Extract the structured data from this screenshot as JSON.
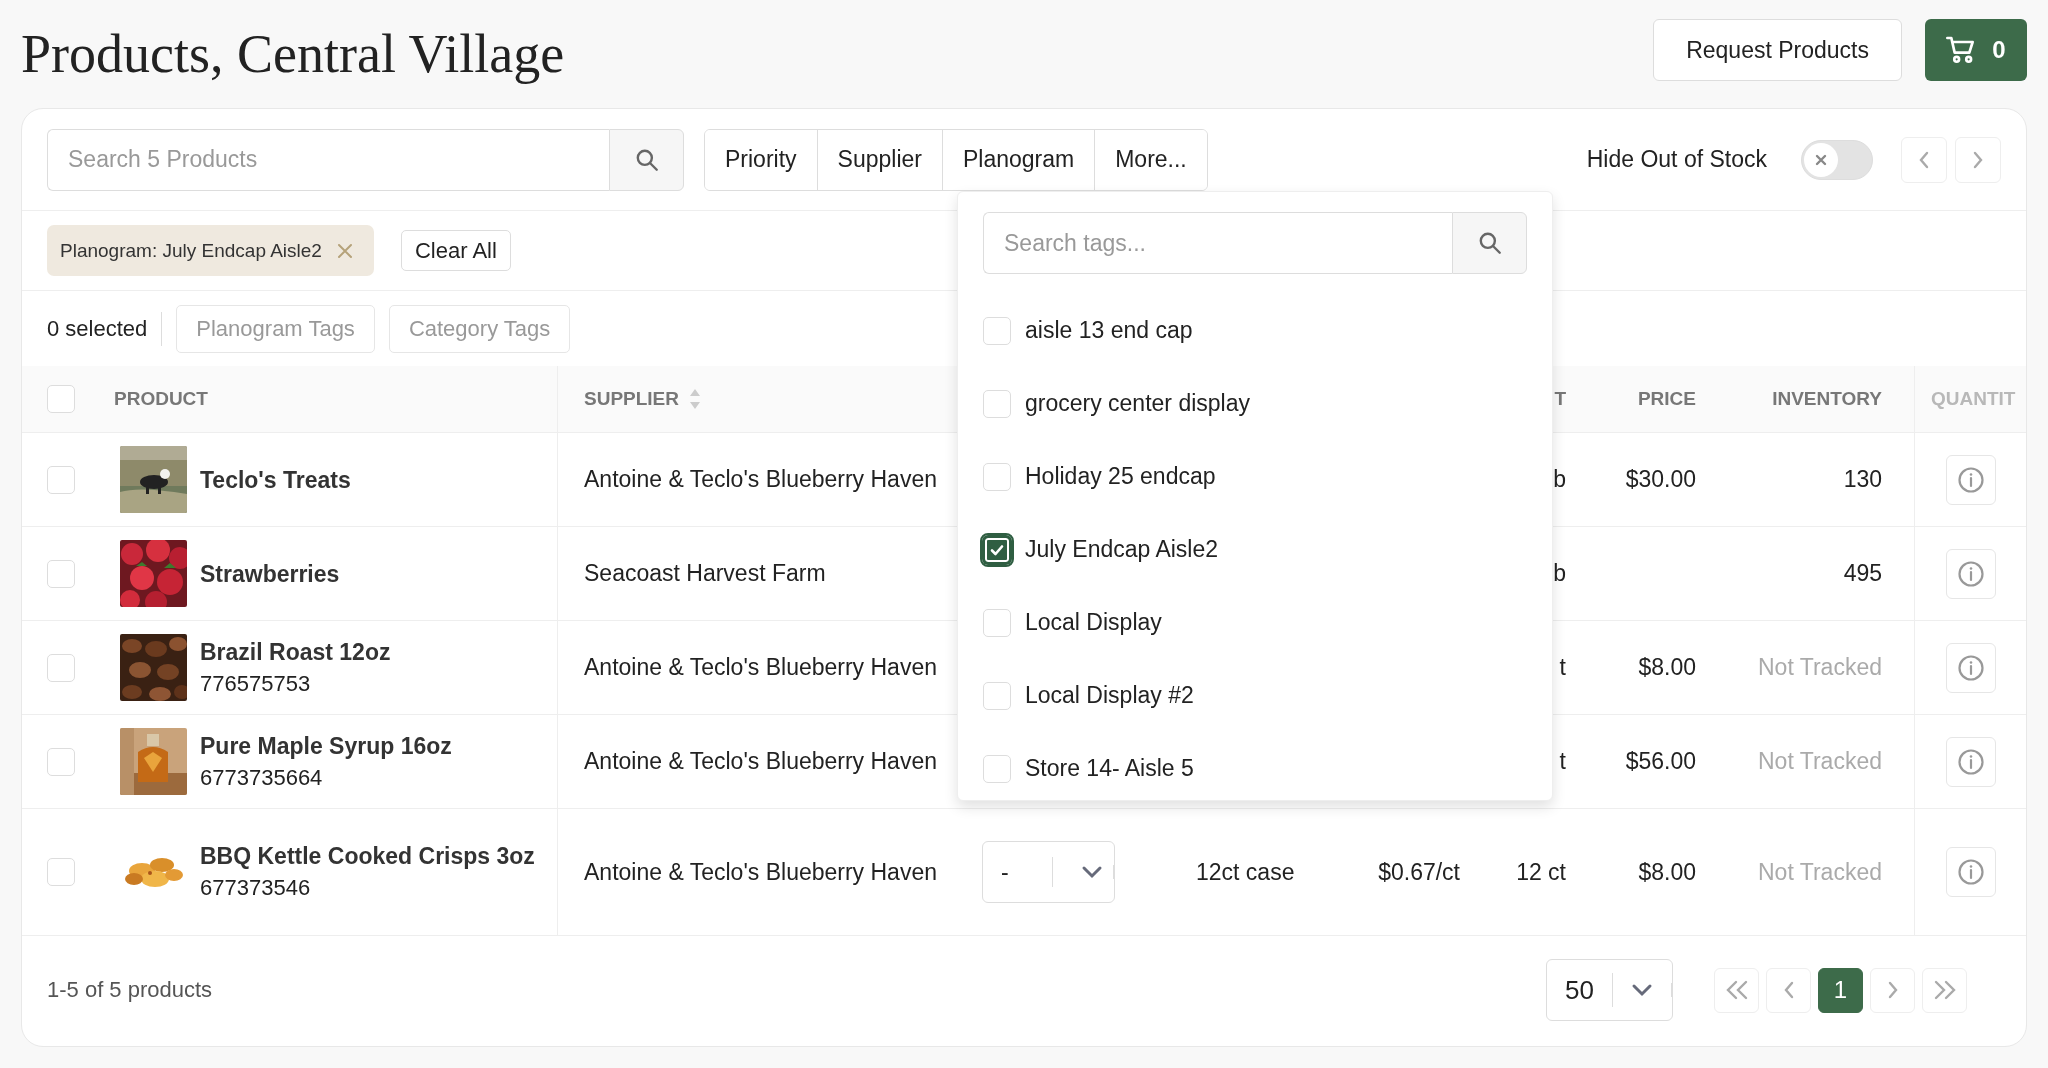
{
  "page": {
    "title": "Products, Central Village"
  },
  "header_actions": {
    "request_button": "Request Products",
    "cart_count": "0"
  },
  "search": {
    "placeholder": "Search 5 Products"
  },
  "filters": [
    {
      "label": "Priority"
    },
    {
      "label": "Supplier"
    },
    {
      "label": "Planogram"
    },
    {
      "label": "More..."
    }
  ],
  "hide_out_of_stock": {
    "label": "Hide Out of Stock",
    "on": false
  },
  "active_filters": [
    {
      "label": "Planogram: July Endcap Aisle2"
    }
  ],
  "clear_all": "Clear All",
  "selection": {
    "count": "0 selected",
    "actions": [
      "Planogram Tags",
      "Category Tags"
    ]
  },
  "table": {
    "select_all": {
      "checked": false
    },
    "columns": {
      "product": "PRODUCT",
      "supplier": "SUPPLIER",
      "column_6": "T",
      "price": "PRICE",
      "inventory": "INVENTORY",
      "quantity": "QUANTIT"
    },
    "rows": [
      {
        "selected": false,
        "name": "Teclo's Treats",
        "supplier": "Antoine & Teclo's Blueberry Haven",
        "column_6": "b",
        "price": "$30.00",
        "inventory": "130",
        "inventory_tracked": true
      },
      {
        "selected": false,
        "name": "Strawberries",
        "supplier": "Seacoast Harvest Farm",
        "column_6": "b",
        "inventory": "495",
        "inventory_tracked": true
      },
      {
        "selected": false,
        "name": "Brazil Roast 12oz",
        "code": "776575753",
        "supplier": "Antoine & Teclo's Blueberry Haven",
        "column_6": "t",
        "price": "$8.00",
        "inventory": "Not Tracked",
        "inventory_tracked": false
      },
      {
        "selected": false,
        "name": "Pure Maple Syrup 16oz",
        "code": "6773735664",
        "supplier": "Antoine & Teclo's Blueberry Haven",
        "column_6": "t",
        "price": "$56.00",
        "inventory": "Not Tracked",
        "inventory_tracked": false
      },
      {
        "selected": false,
        "name": "BBQ Kettle Cooked Crisps 3oz",
        "code": "677373546",
        "supplier": "Antoine & Teclo's Blueberry Haven",
        "pack_select": "-",
        "column_4": "12ct case",
        "column_5": "$0.67/ct",
        "column_6": "12 ct",
        "price": "$8.00",
        "inventory": "Not Tracked",
        "inventory_tracked": false
      }
    ]
  },
  "tag_dropdown": {
    "search_placeholder": "Search tags...",
    "options": [
      {
        "label": "aisle 13 end cap",
        "checked": false
      },
      {
        "label": "grocery center display",
        "checked": false
      },
      {
        "label": "Holiday 25 endcap",
        "checked": false
      },
      {
        "label": "July Endcap Aisle2",
        "checked": true
      },
      {
        "label": "Local Display",
        "checked": false
      },
      {
        "label": "Local Display #2",
        "checked": false
      },
      {
        "label": "Store 14- Aisle 5",
        "checked": false
      }
    ]
  },
  "pagination": {
    "summary": "1-5 of 5 products",
    "page_size": "50",
    "pages": [
      {
        "label": "1",
        "selected": true
      }
    ]
  }
}
